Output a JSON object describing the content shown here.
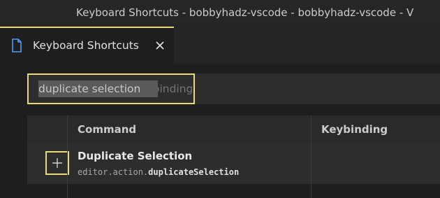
{
  "window": {
    "title": "Keyboard Shortcuts - bobbyhadz-vscode - bobbyhadz-vscode - V"
  },
  "tabs": [
    {
      "label": "Keyboard Shortcuts",
      "icon": "file-icon",
      "active": true
    }
  ],
  "search": {
    "value": "duplicate selection",
    "placeholder": "Type to search in keybindings"
  },
  "table": {
    "headers": {
      "command": "Command",
      "keybinding": "Keybinding"
    },
    "rows": [
      {
        "command": "Duplicate Selection",
        "id_prefix": "editor.action.",
        "id_name": "duplicateSelection",
        "keybinding": ""
      }
    ]
  },
  "colors": {
    "accent": "#e6db74",
    "background": "#1e1e1e",
    "file_icon": "#4a9eff"
  }
}
